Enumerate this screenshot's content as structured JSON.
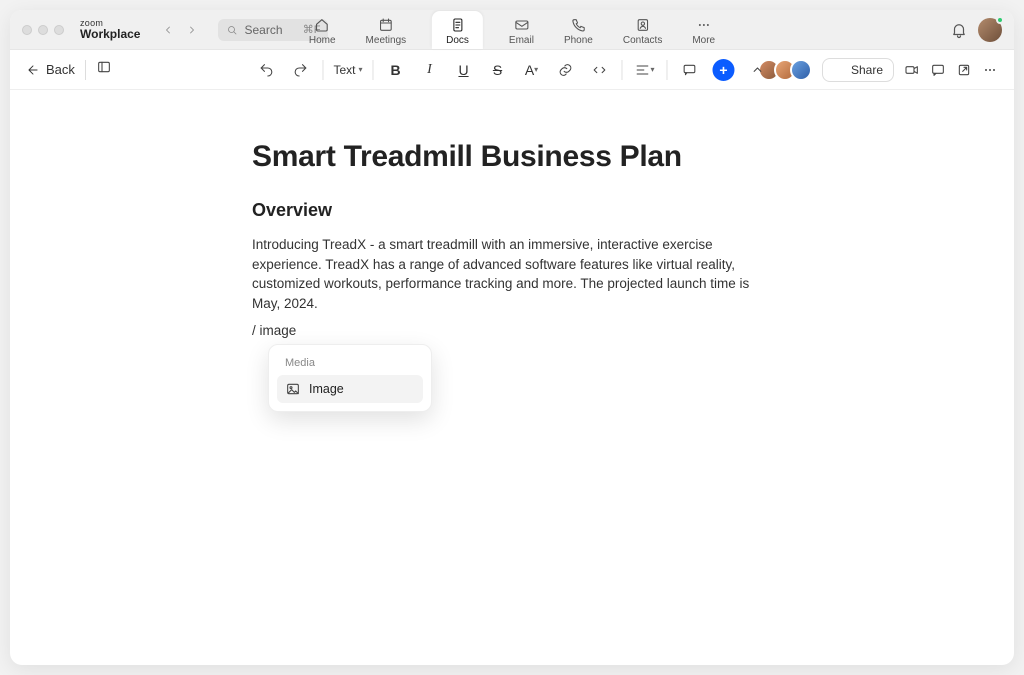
{
  "brand": {
    "top": "zoom",
    "bottom": "Workplace"
  },
  "search": {
    "placeholder": "Search",
    "shortcut": "⌘F"
  },
  "topnav": {
    "home": "Home",
    "meetings": "Meetings",
    "docs": "Docs",
    "email": "Email",
    "phone": "Phone",
    "contacts": "Contacts",
    "more": "More"
  },
  "toolbar": {
    "back": "Back",
    "text_menu": "Text",
    "share": "Share"
  },
  "collaborators": [
    {
      "color1": "#d48b63",
      "color2": "#8a5a3b"
    },
    {
      "color1": "#e8a677",
      "color2": "#b26a3c"
    },
    {
      "color1": "#6aa0e0",
      "color2": "#2f5fa8"
    }
  ],
  "document": {
    "title": "Smart Treadmill Business Plan",
    "h2": "Overview",
    "body": "Introducing TreadX - a smart treadmill with an immersive, interactive exercise experience. TreadX has a range of advanced software features like virtual reality, customized workouts, performance tracking and more. The projected launch time is May, 2024.",
    "slash_input": "/ image"
  },
  "slash_menu": {
    "section": "Media",
    "item_image": "Image"
  }
}
